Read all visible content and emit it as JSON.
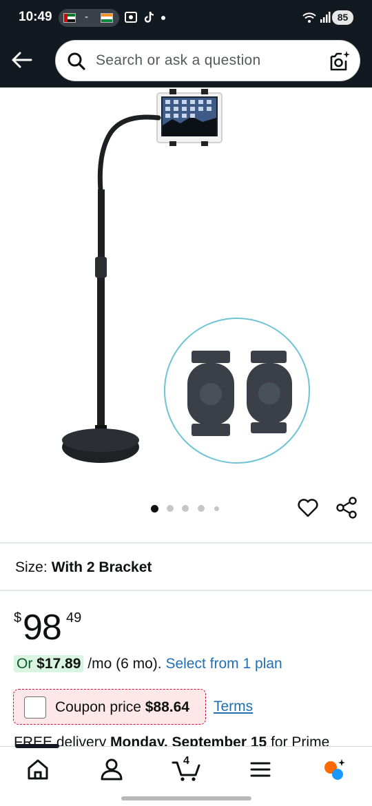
{
  "status_bar": {
    "time": "10:49",
    "separator": "-",
    "battery": "85",
    "flags": [
      "flag-uae",
      "flag-india"
    ],
    "icons": [
      "screenshot-icon",
      "tiktok-icon",
      "dot-icon",
      "wifi-icon",
      "signal-icon"
    ]
  },
  "header": {
    "search_placeholder": "Search or ask a question",
    "back_icon": "back-arrow-icon",
    "camera_icon": "camera-search-icon",
    "bg_color": "#131921"
  },
  "gallery": {
    "image_count": 5,
    "active_index": 0,
    "image_alt": "Floor tablet stand with gooseneck arm and 2 brackets"
  },
  "size": {
    "label": "Size:",
    "value": "With 2 Bracket"
  },
  "price": {
    "currency": "$",
    "whole": "98",
    "fraction": "49"
  },
  "installment": {
    "prefix": "Or ",
    "amount": "$17.89",
    "suffix": " /mo (6 mo). ",
    "link": "Select from 1 plan"
  },
  "coupon": {
    "label": "Coupon price ",
    "amount": "$88.64",
    "terms": "Terms"
  },
  "delivery": {
    "prefix": "FREE delivery ",
    "date": "Monday, September 15",
    "suffix": " for Prime"
  },
  "bottom_nav": {
    "cart_count": "4",
    "items": [
      "home-icon",
      "account-icon",
      "cart-icon",
      "menu-icon",
      "rufus-icon"
    ]
  },
  "colors": {
    "link": "#1f6fb2",
    "installment_bg": "#d9f4e1",
    "coupon_bg": "#fde7e9",
    "coupon_border": "#cc0c39",
    "rufus_orange": "#ff6a00",
    "rufus_blue": "#1a98ff"
  }
}
